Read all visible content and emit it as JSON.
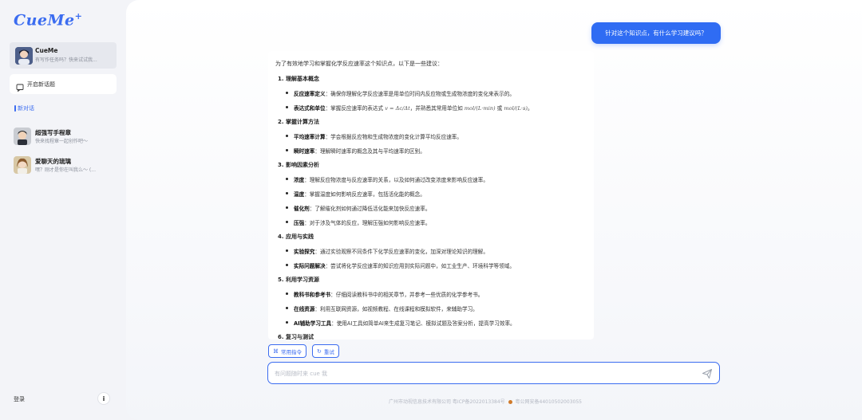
{
  "sidebar": {
    "logo": "CueMe",
    "logo_mark": "+",
    "agent": {
      "name": "CueMe",
      "desc": "有写作任务吗？快来试试我..."
    },
    "new_topic_label": "开启新话题",
    "section_title": "新对话",
    "chats": [
      {
        "title": "超强写手程章",
        "sub": "快来找程章一起创作吧～"
      },
      {
        "title": "爱聊天的琉璃",
        "sub": "嘿？刚才是你在叫我么～ (..."
      }
    ],
    "login_label": "登录",
    "info_icon": "i"
  },
  "conversation": {
    "user_message": "针对这个知识点，有什么学习建议吗？",
    "answer": {
      "intro": "为了有效地学习和掌握化学反应速率这个知识点，以下是一些建议：",
      "sections": [
        {
          "heading": "1. 理解基本概念",
          "items": [
            {
              "term": "反应速率定义",
              "text": "：确保你理解化学反应速率是用单位时间内反应物或生成物浓度的变化来表示的。"
            },
            {
              "term": "表达式和单位",
              "text": "：掌握反应速率的表达式",
              "formula": "v = Δc/Δt",
              "text2": "，并熟悉其常用单位如",
              "unit1": "mol/(L·min)",
              "or": "或",
              "unit2": "mol/(L·s)",
              "end": "。"
            }
          ]
        },
        {
          "heading": "2. 掌握计算方法",
          "items": [
            {
              "term": "平均速率计算",
              "text": "：学会根据反应物和生成物浓度的变化计算平均反应速率。"
            },
            {
              "term": "瞬时速率",
              "text": "：理解瞬时速率的概念及其与平均速率的区别。"
            }
          ]
        },
        {
          "heading": "3. 影响因素分析",
          "items": [
            {
              "term": "浓度",
              "text": "：理解反应物浓度与反应速率的关系，以及如何通过改变浓度来影响反应速率。"
            },
            {
              "term": "温度",
              "text": "：掌握温度如何影响反应速率，包括活化能的概念。"
            },
            {
              "term": "催化剂",
              "text": "：了解催化剂如何通过降低活化能来加快反应速率。"
            },
            {
              "term": "压强",
              "text": "：对于涉及气体的反应，理解压强如何影响反应速率。"
            }
          ]
        },
        {
          "heading": "4. 应用与实践",
          "items": [
            {
              "term": "实验探究",
              "text": "：通过实验观察不同条件下化学反应速率的变化，加深对理论知识的理解。"
            },
            {
              "term": "实际问题解决",
              "text": "：尝试将化学反应速率的知识应用到实际问题中，如工业生产、环境科学等领域。"
            }
          ]
        },
        {
          "heading": "5. 利用学习资源",
          "items": [
            {
              "term": "教科书和参考书",
              "text": "：仔细阅读教科书中的相关章节，并参考一些优质的化学参考书。"
            },
            {
              "term": "在线资源",
              "text": "：利用互联网资源，如视频教程、在线课程和模拟软件，来辅助学习。"
            },
            {
              "term": "AI辅助学习工具",
              "text": "：使用AI工具如简单AI来生成复习笔记、模拟试题及答案分析，提高学习效率。"
            }
          ]
        },
        {
          "heading": "6. 复习与测试",
          "items": []
        }
      ]
    }
  },
  "actions": {
    "common_commands": "常用指令",
    "retry": "重试"
  },
  "input": {
    "placeholder": "有问题随时来 cue 我"
  },
  "footer": {
    "company": "广州市动视信息技术有限公司 粤ICP备2022013384号",
    "police": "粤公网安备44010502003055"
  },
  "colors": {
    "accent": "#3b6cf0",
    "user_bubble": "#2f6cf3",
    "sidebar_bg": "#f3f4f8"
  }
}
